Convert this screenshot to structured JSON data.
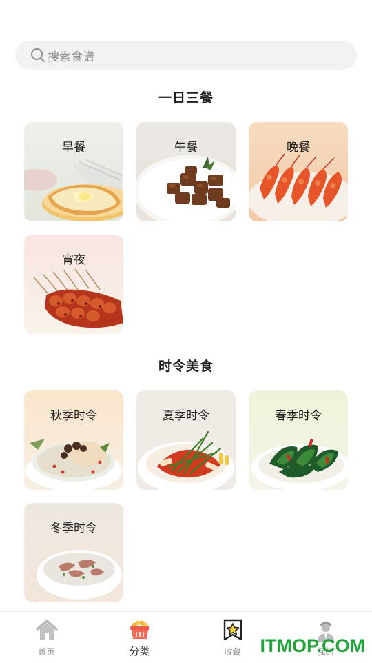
{
  "search": {
    "placeholder": "搜索食谱"
  },
  "sections": [
    {
      "title": "一日三餐",
      "cards": [
        {
          "label": "早餐",
          "image": "toast-with-butter"
        },
        {
          "label": "午餐",
          "image": "braised-pork-cubes"
        },
        {
          "label": "晚餐",
          "image": "fried-shrimp"
        },
        {
          "label": "宵夜",
          "image": "grilled-skewers"
        }
      ]
    },
    {
      "title": "时令美食",
      "cards": [
        {
          "label": "秋季时令",
          "image": "chicken-soup"
        },
        {
          "label": "夏季时令",
          "image": "cold-noodles"
        },
        {
          "label": "春季时令",
          "image": "stir-fried-greens"
        },
        {
          "label": "冬季时令",
          "image": "mutton-soup"
        }
      ]
    }
  ],
  "tabbar": {
    "items": [
      {
        "label": "首页",
        "icon": "home-icon",
        "active": false
      },
      {
        "label": "分类",
        "icon": "basket-icon",
        "active": true
      },
      {
        "label": "收藏",
        "icon": "bookmark-star-icon",
        "active": false
      },
      {
        "label": "我的",
        "icon": "profile-icon",
        "active": false
      }
    ]
  },
  "watermark": "ITMOP.COM"
}
